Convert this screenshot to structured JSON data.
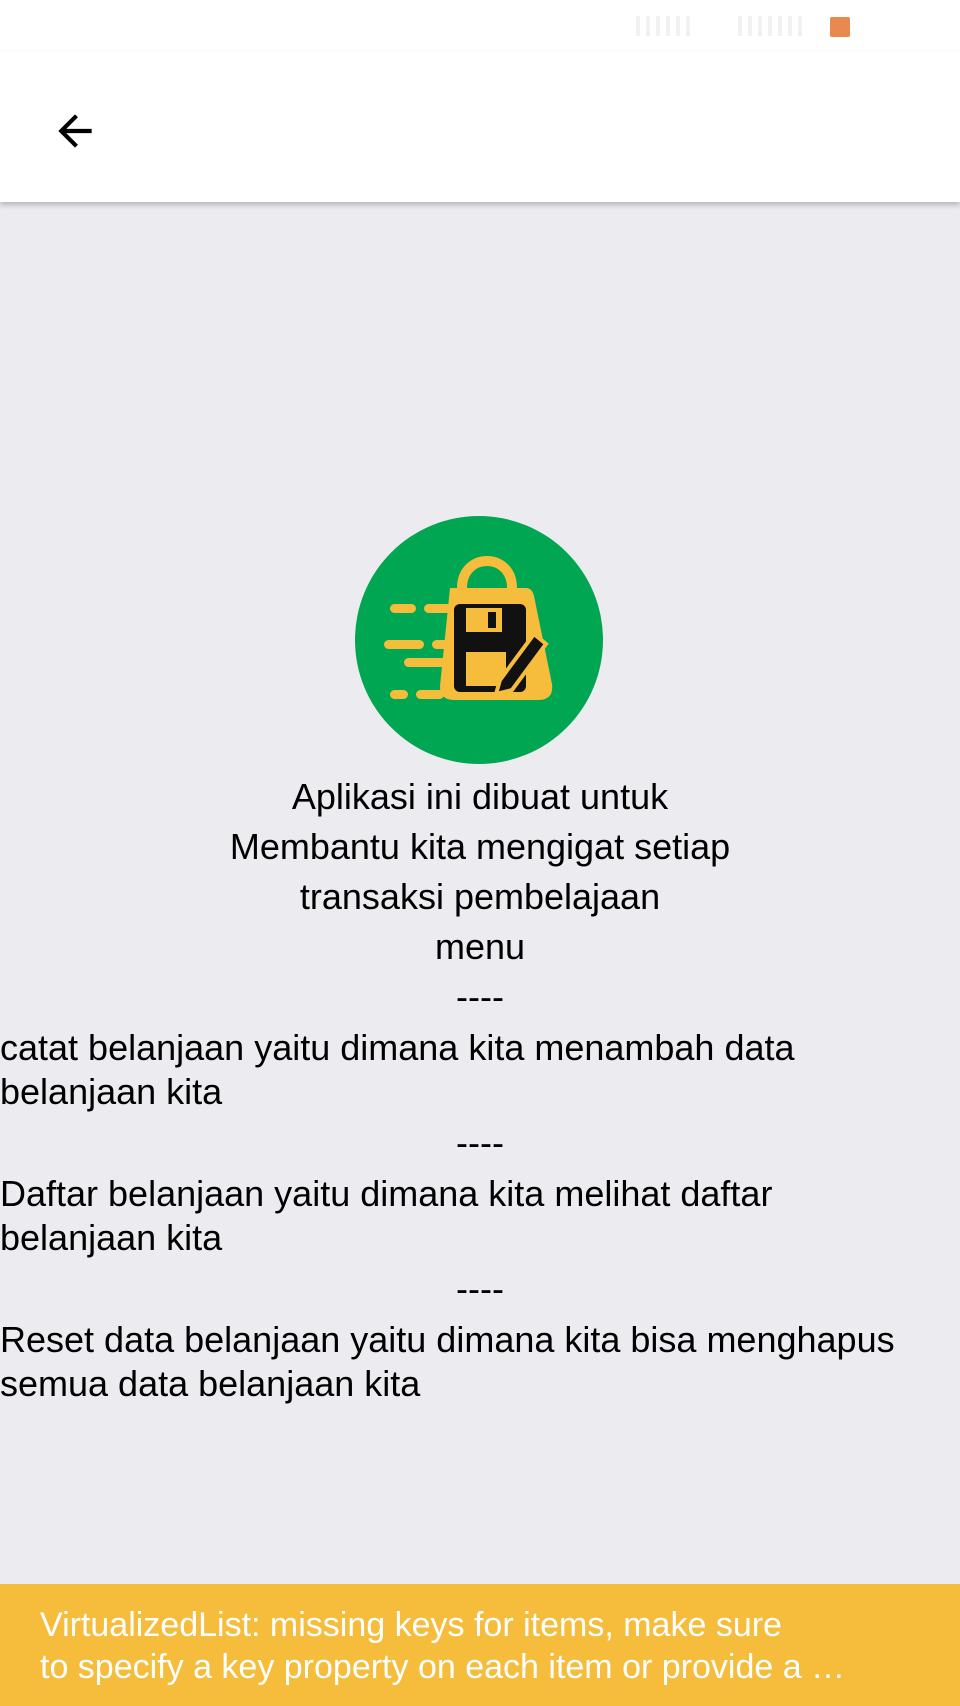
{
  "status_bar": {
    "accent_color": "#e8894f"
  },
  "app_bar": {
    "back_icon": "arrow-left-icon"
  },
  "logo": {
    "icon": "shopping-bag-floppy-pencil-icon",
    "circle_color": "#00a651",
    "bag_color": "#f5bd3b"
  },
  "content": {
    "intro_lines": [
      "Aplikasi ini dibuat untuk",
      "Membantu kita mengigat setiap",
      "transaksi pembelajaan",
      "menu"
    ],
    "separator": "----",
    "menu_descriptions": [
      {
        "line1": "catat belanjaan yaitu dimana kita menambah data",
        "line2": "belanjaan kita"
      },
      {
        "line1": "Daftar belanjaan yaitu dimana kita melihat daftar",
        "line2": "belanjaan kita"
      },
      {
        "line1": "Reset data belanjaan yaitu dimana kita bisa menghapus",
        "line2": "semua data belanjaan kita"
      }
    ]
  },
  "toast": {
    "line1": "VirtualizedList: missing keys for items, make sure",
    "line2": "to specify a key property on each item or provide a …",
    "background_color": "#f5bd3b"
  }
}
